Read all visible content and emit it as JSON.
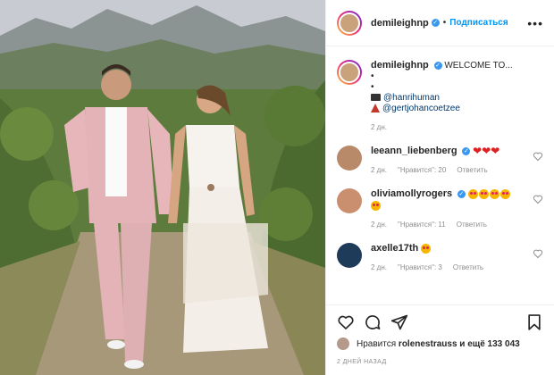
{
  "header": {
    "username": "demileighnp",
    "separator": "•",
    "follow_label": "Подписаться",
    "more_label": "•••"
  },
  "caption": {
    "username": "demileighnp",
    "text": "WELCOME TO...",
    "bullet1": "•",
    "bullet2": "•",
    "mention1": "@hanrihuman",
    "mention2": "@gertjohancoetzee",
    "time": "2 дн."
  },
  "comments": [
    {
      "username": "leeann_liebenberg",
      "time": "2 дн.",
      "likes": "\"Нравится\": 20",
      "reply": "Ответить"
    },
    {
      "username": "oliviamollyrogers",
      "time": "2 дн.",
      "likes": "\"Нравится\": 11",
      "reply": "Ответить"
    },
    {
      "username": "axelle17th",
      "time": "2 дн.",
      "likes": "\"Нравится\": 3",
      "reply": "Ответить"
    }
  ],
  "likes_line": {
    "prefix": "Нравится",
    "user": "rolenestrauss",
    "and_more": "и ещё 133 043"
  },
  "post_date": "2 ДНЕЙ НАЗАД",
  "icons": [
    "heart-icon",
    "comment-icon",
    "share-icon",
    "bookmark-icon",
    "verified-icon",
    "ellipsis-icon"
  ]
}
